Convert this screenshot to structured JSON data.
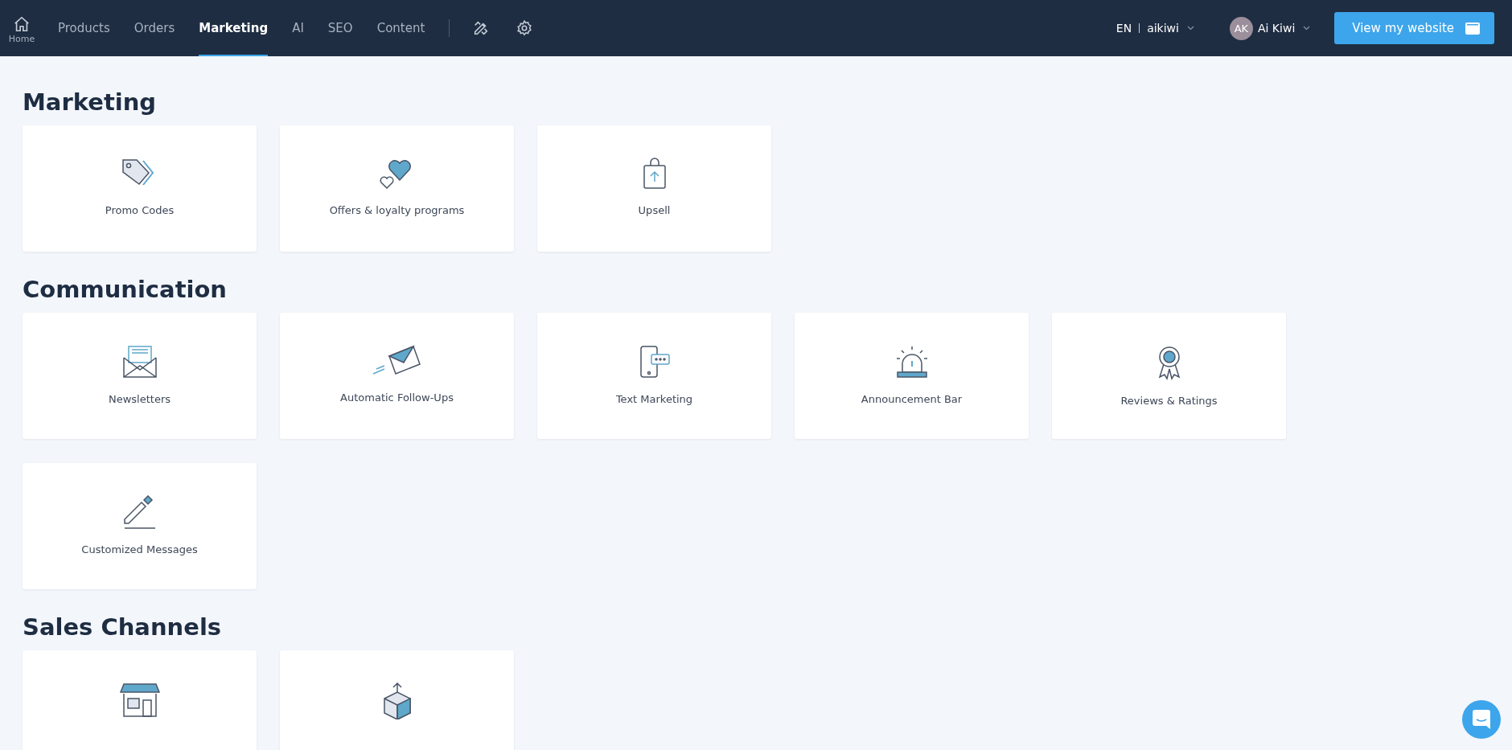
{
  "nav": {
    "home": "Home",
    "tabs": [
      {
        "label": "Products",
        "selected": false
      },
      {
        "label": "Orders",
        "selected": false
      },
      {
        "label": "Marketing",
        "selected": true
      },
      {
        "label": "AI",
        "selected": false
      },
      {
        "label": "SEO",
        "selected": false
      },
      {
        "label": "Content",
        "selected": false
      }
    ],
    "language": "EN",
    "store": "aikiwi",
    "avatar": "AK",
    "user": "Ai Kiwi",
    "view_button": "View my website"
  },
  "sections": [
    {
      "title": "Marketing",
      "cards": [
        {
          "kind": "tag",
          "label": "Promo Codes"
        },
        {
          "kind": "hearts",
          "label": "Offers & loyalty programs"
        },
        {
          "kind": "bag",
          "label": "Upsell"
        }
      ]
    },
    {
      "title": "Communication",
      "cards": [
        {
          "kind": "envelope",
          "label": "Newsletters"
        },
        {
          "kind": "plane",
          "label": "Automatic Follow-Ups"
        },
        {
          "kind": "phone",
          "label": "Text Marketing"
        },
        {
          "kind": "siren",
          "label": "Announcement Bar"
        },
        {
          "kind": "ribbon",
          "label": "Reviews & Ratings"
        },
        {
          "kind": "pencil",
          "label": "Customized Messages"
        }
      ]
    },
    {
      "title": "Sales Channels",
      "cards": [
        {
          "kind": "store"
        },
        {
          "kind": "box"
        }
      ]
    }
  ]
}
